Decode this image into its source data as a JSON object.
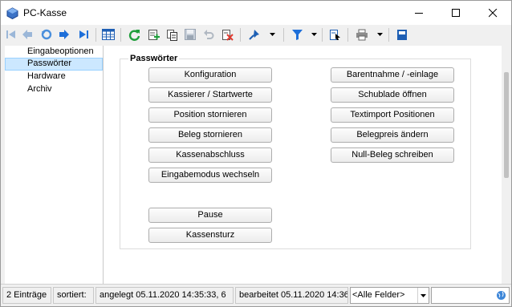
{
  "window": {
    "title": "PC-Kasse"
  },
  "nav": {
    "items": [
      "Eingabeoptionen",
      "Passwörter",
      "Hardware",
      "Archiv"
    ],
    "selected_index": 1
  },
  "group": {
    "title": "Passwörter"
  },
  "buttons_left": [
    "Konfiguration",
    "Kassierer / Startwerte",
    "Position stornieren",
    "Beleg stornieren",
    "Kassenabschluss",
    "Eingabemodus wechseln"
  ],
  "buttons_left_bottom": [
    "Pause",
    "Kassensturz"
  ],
  "buttons_right": [
    "Barentnahme / -einlage",
    "Schublade öffnen",
    "Textimport Positionen",
    "Belegpreis ändern",
    "Null-Beleg schreiben"
  ],
  "status": {
    "count": "2 Einträge",
    "sorted": "sortiert:",
    "created": "angelegt 05.11.2020 14:35:33,  6",
    "edited": "bearbeitet 05.11.2020 14:36:",
    "field_filter": "<Alle Felder>"
  },
  "colors": {
    "selection": "#cce8ff",
    "selection_border": "#99d1ff",
    "accent_blue": "#1e6fd9",
    "accent_green": "#1f9e3b",
    "accent_red": "#e03a2f"
  }
}
